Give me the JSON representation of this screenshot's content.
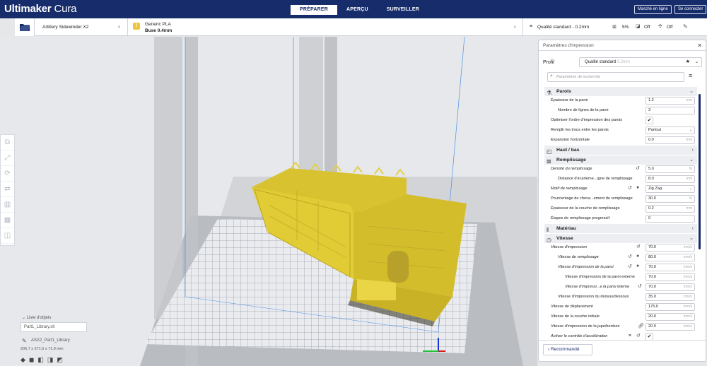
{
  "app": {
    "brand_bold": "Ultimaker",
    "brand_light": " Cura"
  },
  "tabs": [
    "PRÉPARER",
    "APERÇU",
    "SURVEILLER"
  ],
  "topbar": {
    "marketplace": "Marché en ligne",
    "login": "Se connecter"
  },
  "printer": {
    "name": "Artillery Sidewinder X2",
    "material": "Generic PLA",
    "nozzle": "Buse 0.4mm",
    "profile_summary": "Qualité standard - 0.2mm",
    "infill": "5%",
    "support": "Off",
    "adhesion": "Off"
  },
  "panel": {
    "title": "Paramètres d'impression",
    "profile_label": "Profil",
    "profile_value": "Qualité standard",
    "profile_detail": "0.2mm",
    "search_placeholder": "Paramètres de recherche",
    "recommended": "Recommandé",
    "categories": {
      "walls": "Parois",
      "topbottom": "Haut / bas",
      "infill": "Remplissage",
      "material": "Matériau",
      "speed": "Vitesse"
    },
    "settings": [
      {
        "label": "Épaisseur de la paroi",
        "value": "1.2",
        "unit": "mm"
      },
      {
        "label": "Nombre de lignes de la paroi",
        "value": "3",
        "unit": ""
      },
      {
        "label": "Optimiser l'ordre d'impression des parois",
        "value": "✔",
        "unit": ""
      },
      {
        "label": "Remplir les trous entre les parois",
        "value": "Partout",
        "unit": ""
      },
      {
        "label": "Expansion horizontale",
        "value": "0.0",
        "unit": "mm"
      },
      {
        "label": "Densité du remplissage",
        "value": "5.0",
        "unit": "%"
      },
      {
        "label": "Distance d'écarteme...igne de remplissage",
        "value": "8.0",
        "unit": "mm"
      },
      {
        "label": "Motif de remplissage",
        "value": "Zig Zag",
        "unit": ""
      },
      {
        "label": "Pourcentage de cheva...ement du remplissage",
        "value": "30.0",
        "unit": "%"
      },
      {
        "label": "Épaisseur de la couche de remplissage",
        "value": "0.2",
        "unit": "mm"
      },
      {
        "label": "Étapes de remplissage progressif",
        "value": "0",
        "unit": ""
      },
      {
        "label": "Vitesse d'impression",
        "value": "70.0",
        "unit": "mm/s"
      },
      {
        "label": "Vitesse de remplissage",
        "value": "80.0",
        "unit": "mm/s"
      },
      {
        "label": "Vitesse d'impression de la paroi",
        "value": "70.0",
        "unit": "mm/s"
      },
      {
        "label": "Vitesse d'impression de la paroi externe",
        "value": "70.0",
        "unit": "mm/s"
      },
      {
        "label": "Vitesse d'impressi...e la paroi interne",
        "value": "70.0",
        "unit": "mm/s"
      },
      {
        "label": "Vitesse d'impression du dessus/dessous",
        "value": "35.0",
        "unit": "mm/s"
      },
      {
        "label": "Vitesse de déplacement",
        "value": "175.0",
        "unit": "mm/s"
      },
      {
        "label": "Vitesse de la couche initiale",
        "value": "20.0",
        "unit": "mm/s"
      },
      {
        "label": "Vitesse d'impression de la jupe/bordure",
        "value": "20.0",
        "unit": "mm/s"
      },
      {
        "label": "Activer le contrôle d'accélération",
        "value": "✔",
        "unit": ""
      }
    ]
  },
  "objects": {
    "header": "Liste d'objets",
    "file": "Part1_Library.stl",
    "model": "ASX2_Part1_Library",
    "dims": "206.7 x 271.6 x 71.9 mm"
  }
}
